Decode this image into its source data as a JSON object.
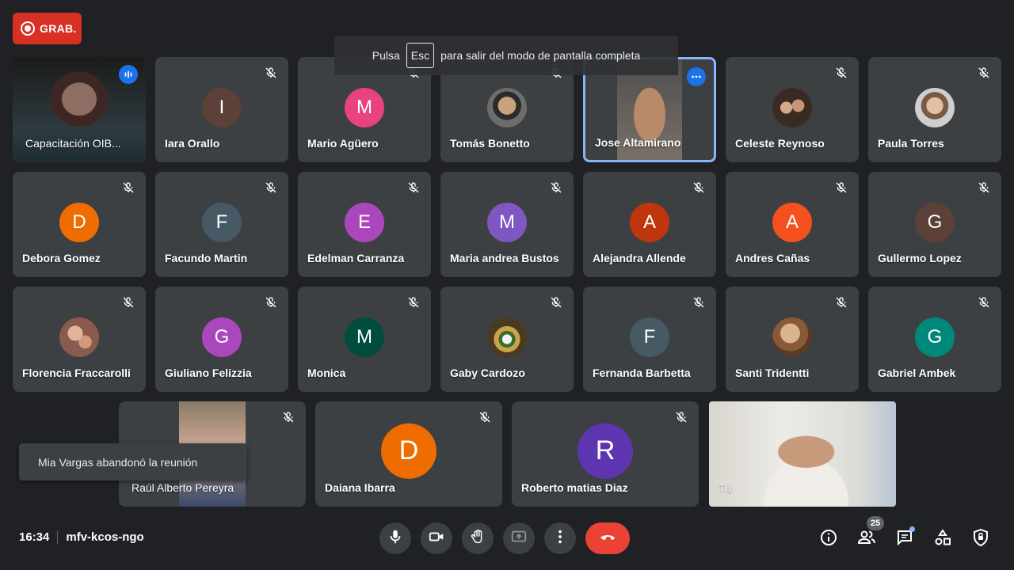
{
  "recording": {
    "label": "GRAB."
  },
  "fullscreen_hint": {
    "before": "Pulsa",
    "key": "Esc",
    "after": "para salir del modo de pantalla completa"
  },
  "toast": {
    "text": "Mia Vargas abandonó la reunión"
  },
  "footer": {
    "time": "16:34",
    "meeting_code": "mfv-kcos-ngo",
    "participants_count": "25"
  },
  "colors": {
    "accent": "#8ab4f8",
    "recording": "#d93025",
    "end_call": "#ea4335",
    "tile_bg": "#3c4043",
    "page_bg": "#202124"
  },
  "participants": [
    {
      "name": "Capacitación OIB...",
      "type": "video",
      "speaking": true
    },
    {
      "name": "Iara Orallo",
      "initial": "I",
      "color": "#5d4037"
    },
    {
      "name": "Mario Agüero",
      "initial": "M",
      "color": "#e8437f"
    },
    {
      "name": "Tomás Bonetto",
      "type": "photo"
    },
    {
      "name": "Jose Altamirano",
      "type": "video",
      "active": true
    },
    {
      "name": "Celeste Reynoso",
      "type": "photo"
    },
    {
      "name": "Paula Torres",
      "type": "photo"
    },
    {
      "name": "Debora Gomez",
      "initial": "D",
      "color": "#ef6c00"
    },
    {
      "name": "Facundo Martin",
      "initial": "F",
      "color": "#455a64"
    },
    {
      "name": "Edelman Carranza",
      "initial": "E",
      "color": "#ab47bc"
    },
    {
      "name": "Maria andrea Bustos",
      "initial": "M",
      "color": "#7e57c2"
    },
    {
      "name": "Alejandra Allende",
      "initial": "A",
      "color": "#bf360c"
    },
    {
      "name": "Andres Cañas",
      "initial": "A",
      "color": "#f4511e"
    },
    {
      "name": "Gullermo Lopez",
      "initial": "G",
      "color": "#5d4037"
    },
    {
      "name": "Florencia Fraccarolli",
      "type": "photo"
    },
    {
      "name": "Giuliano Felizzia",
      "initial": "G",
      "color": "#ab47bc"
    },
    {
      "name": "Monica",
      "initial": "M",
      "color": "#004d40"
    },
    {
      "name": "Gaby Cardozo",
      "type": "photo"
    },
    {
      "name": "Fernanda Barbetta",
      "initial": "F",
      "color": "#455a64"
    },
    {
      "name": "Santi Tridentti",
      "type": "photo"
    },
    {
      "name": "Gabriel Ambek",
      "initial": "G",
      "color": "#00897b"
    },
    {
      "name": "Raúl Alberto Pereyra",
      "type": "video"
    },
    {
      "name": "Daiana Ibarra",
      "initial": "D",
      "color": "#ef6c00"
    },
    {
      "name": "Roberto matias Diaz",
      "initial": "R",
      "color": "#5e35b1"
    },
    {
      "name": "Tú",
      "type": "video"
    }
  ],
  "icons": {
    "mute": "mic-off-icon",
    "mic": "mic-icon",
    "camera": "videocam-icon",
    "hand": "raise-hand-icon",
    "present": "present-screen-icon",
    "more": "more-vert-icon",
    "end": "call-end-icon",
    "info": "info-icon",
    "people": "people-icon",
    "chat": "chat-icon",
    "activities": "activities-icon",
    "safety": "host-controls-icon"
  }
}
